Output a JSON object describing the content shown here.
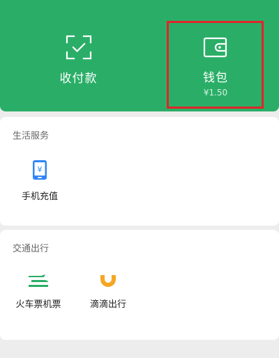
{
  "header": {
    "pay": {
      "label": "收付款",
      "icon": "scan-pay-icon"
    },
    "wallet": {
      "label": "钱包",
      "balance": "¥1.50",
      "icon": "wallet-icon"
    }
  },
  "sections": {
    "life_services": {
      "title": "生活服务",
      "items": [
        {
          "label": "手机充值",
          "icon": "phone-recharge-icon"
        }
      ]
    },
    "transport": {
      "title": "交通出行",
      "items": [
        {
          "label": "火车票机票",
          "icon": "train-ticket-icon"
        },
        {
          "label": "滴滴出行",
          "icon": "didi-icon"
        }
      ]
    }
  },
  "colors": {
    "brand_green": "#2aae67",
    "highlight_red": "#e0252a",
    "phone_blue": "#2f86f6",
    "didi_orange": "#f5a623"
  }
}
